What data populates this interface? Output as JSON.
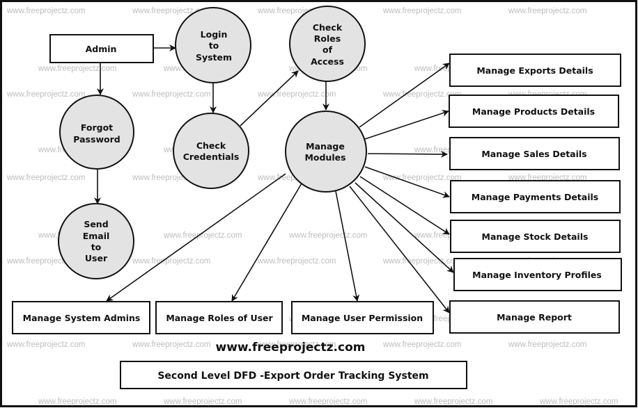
{
  "watermark": "www.freeprojectz.com",
  "site_label": "www.freeprojectz.com",
  "title": "Second Level DFD -Export Order Tracking System",
  "colors": {
    "process_fill": "#e3e3e3",
    "stroke": "#111111",
    "watermark": "#bdbdbd"
  },
  "entities": {
    "admin": "Admin",
    "manage_exports": "Manage Exports Details",
    "manage_products": "Manage Products Details",
    "manage_sales": "Manage Sales Details",
    "manage_payments": "Manage Payments Details",
    "manage_stock": "Manage Stock Details",
    "manage_inventory": "Manage Inventory Profiles",
    "manage_report": "Manage  Report",
    "manage_system_admins": "Manage System Admins",
    "manage_roles": "Manage Roles of User",
    "manage_permission": "Manage User Permission"
  },
  "processes": {
    "login": [
      "Login",
      "to",
      "System"
    ],
    "check_roles": [
      "Check",
      "Roles",
      "of",
      "Access"
    ],
    "forgot_password": [
      "Forgot",
      "Password"
    ],
    "check_credentials": [
      "Check",
      "Credentials"
    ],
    "manage_modules": [
      "Manage",
      "Modules"
    ],
    "send_email": [
      "Send",
      "Email",
      "to",
      "User"
    ]
  }
}
